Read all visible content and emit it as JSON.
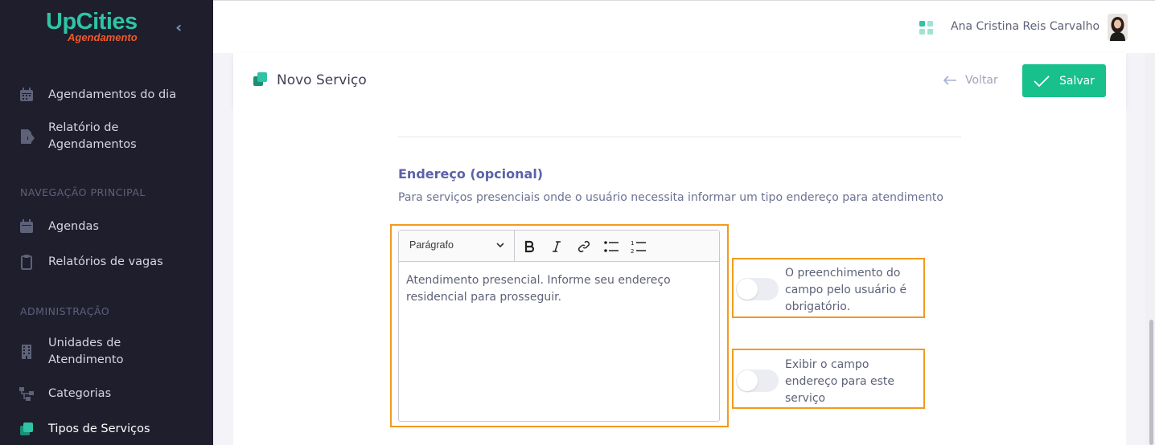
{
  "sidebar": {
    "brand_main": "UpCities",
    "brand_sub": "Agendamento",
    "items_top": [
      {
        "label": "Agendamentos do dia",
        "icon": "calendar-icon"
      },
      {
        "label": "Relatório de\nAgendamentos",
        "icon": "file-export-icon"
      }
    ],
    "section_nav": "NAVEGAÇÃO PRINCIPAL",
    "items_nav": [
      {
        "label": "Agendas",
        "icon": "calendar-icon"
      },
      {
        "label": "Relatórios de vagas",
        "icon": "clipboard-icon"
      }
    ],
    "section_admin": "ADMINISTRAÇÃO",
    "items_admin": [
      {
        "label": "Unidades de\nAtendimento",
        "icon": "building-icon"
      },
      {
        "label": "Categorias",
        "icon": "sitemap-icon"
      },
      {
        "label": "Tipos de Serviços",
        "icon": "layers-icon"
      }
    ]
  },
  "topbar": {
    "user_name": "Ana Cristina Reis Carvalho"
  },
  "card": {
    "title": "Novo Serviço",
    "back_label": "Voltar",
    "save_label": "Salvar"
  },
  "address": {
    "title": "Endereço (opcional)",
    "description": "Para serviços presenciais onde o usuário necessita informar um tipo endereço para atendimento",
    "editor": {
      "format_select": "Parágrafo",
      "content": "Atendimento presencial. Informe seu endereço residencial para prosseguir."
    },
    "options": [
      {
        "label": "O preenchimento do campo pelo usuário é obrigatório.",
        "checked": false
      },
      {
        "label": "Exibir o campo endereço para este serviço",
        "checked": false
      }
    ]
  },
  "colors": {
    "sidebar_bg": "#1e1e2d",
    "accent_green": "#18c08b",
    "brand_teal": "#2ec4a5",
    "brand_orange": "#f15a29",
    "highlight_orange": "#f29a1f",
    "section_title": "#5a62a8"
  }
}
